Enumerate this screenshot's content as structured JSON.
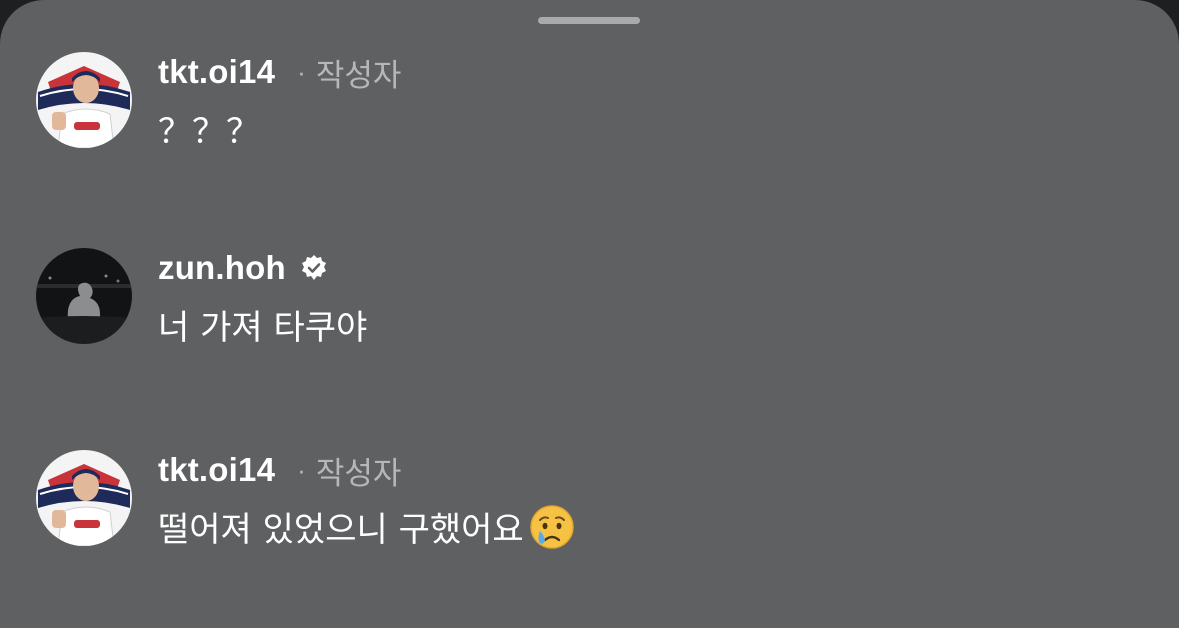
{
  "comments": [
    {
      "username": "tkt.oi14",
      "dot": "·",
      "role": "작성자",
      "text": "？？？",
      "avatar_icon": "doosan-bears-player-avatar"
    },
    {
      "username": "zun.hoh",
      "verified": true,
      "text": "너 가져 타쿠야",
      "avatar_icon": "dark-night-photo-avatar"
    },
    {
      "username": "tkt.oi14",
      "dot": "·",
      "role": "작성자",
      "text": "떨어져 있었으니 구했어요",
      "emoji": "crying-face-emoji",
      "avatar_icon": "doosan-bears-player-avatar"
    }
  ],
  "colors": {
    "sheet": "#5f6062",
    "username": "#ffffff",
    "meta": "#b6b7b9",
    "grabber": "#a9aaac"
  }
}
